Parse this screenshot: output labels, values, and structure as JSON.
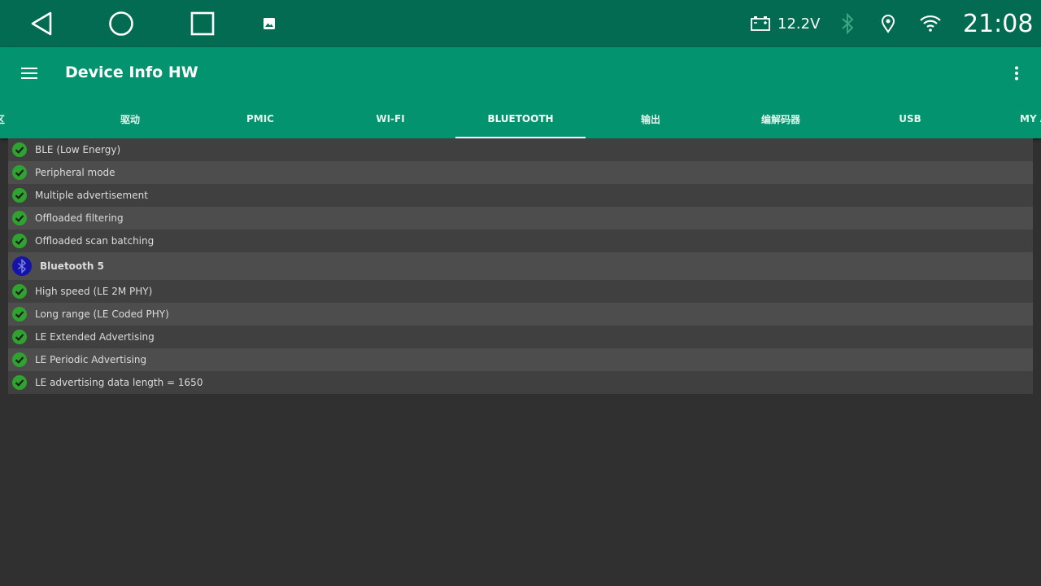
{
  "status_bar": {
    "voltage": "12.2V",
    "clock": "21:08",
    "icons": [
      "back-icon",
      "home-icon",
      "recents-icon",
      "image-icon",
      "battery-icon",
      "bluetooth-icon",
      "location-icon",
      "wifi-icon"
    ]
  },
  "app_bar": {
    "title": "Device Info HW",
    "menu_icon": "menu-icon",
    "overflow_icon": "overflow-icon"
  },
  "tabs": [
    {
      "label": "区"
    },
    {
      "label": "驱动"
    },
    {
      "label": "PMIC"
    },
    {
      "label": "WI-FI"
    },
    {
      "label": "BLUETOOTH",
      "active": true
    },
    {
      "label": "输出"
    },
    {
      "label": "编解码器"
    },
    {
      "label": "USB"
    },
    {
      "label": "MY A"
    }
  ],
  "features": [
    {
      "label": "BLE (Low Energy)",
      "status": "check-icon"
    },
    {
      "label": "Peripheral mode",
      "status": "check-icon"
    },
    {
      "label": "Multiple advertisement",
      "status": "check-icon"
    },
    {
      "label": "Offloaded filtering",
      "status": "check-icon"
    },
    {
      "label": "Offloaded scan batching",
      "status": "check-icon"
    }
  ],
  "bt5_section": {
    "label": "Bluetooth 5",
    "icon": "bluetooth-icon"
  },
  "bt5_features": [
    {
      "label": "High speed (LE 2M PHY)",
      "status": "check-icon"
    },
    {
      "label": "Long range (LE Coded PHY)",
      "status": "check-icon"
    },
    {
      "label": "LE Extended Advertising",
      "status": "check-icon"
    },
    {
      "label": "LE Periodic Advertising",
      "status": "check-icon"
    },
    {
      "label": "LE advertising data length = 1650",
      "status": "check-icon"
    }
  ],
  "colors": {
    "status_bar": "#036b52",
    "app_bar": "#03936e",
    "background": "#303030",
    "check": "#2fa32f",
    "bluetooth_badge": "#1414a8"
  }
}
